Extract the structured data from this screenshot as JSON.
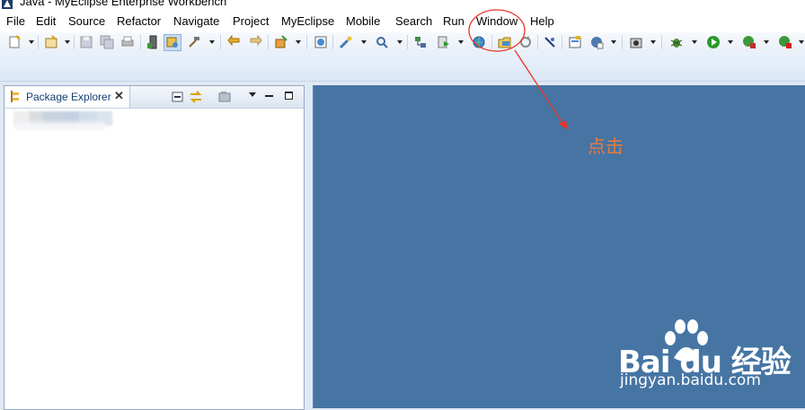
{
  "window": {
    "title": "Java - MyEclipse Enterprise Workbench"
  },
  "menubar": {
    "items": [
      {
        "label": "File"
      },
      {
        "label": "Edit"
      },
      {
        "label": "Source"
      },
      {
        "label": "Refactor"
      },
      {
        "label": "Navigate"
      },
      {
        "label": "Project"
      },
      {
        "label": "MyEclipse"
      },
      {
        "label": "Mobile"
      },
      {
        "label": "Search"
      },
      {
        "label": "Run"
      },
      {
        "label": "Window"
      },
      {
        "label": "Help"
      }
    ]
  },
  "explorer": {
    "tab_label": "Package Explorer",
    "close_glyph": "✕"
  },
  "annotation": {
    "text": "点击",
    "highlighted_menu": "Window",
    "color": "#e8332a"
  },
  "watermark": {
    "brand": "Bai du 经验",
    "url": "jingyan.baidu.com"
  },
  "colors": {
    "editor_bg": "#4675a4",
    "toolbar_bg": "#eaf0f8",
    "tab_text": "#153e72"
  }
}
